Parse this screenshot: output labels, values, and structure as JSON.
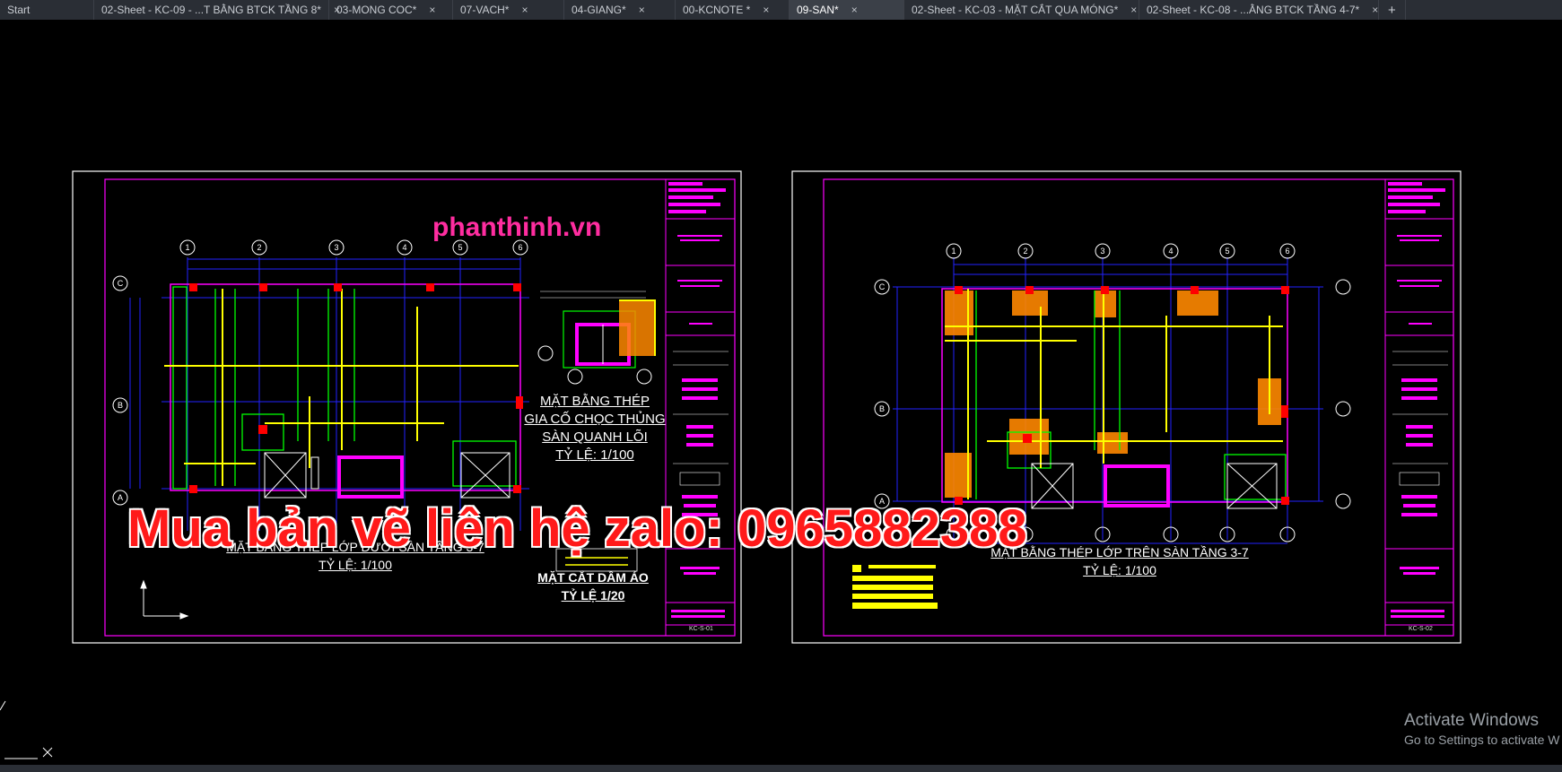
{
  "tabs": [
    {
      "label": "Start",
      "close": false
    },
    {
      "label": "02-Sheet - KC-09 - ...T BẰNG BTCK TẦNG 8*",
      "close": true
    },
    {
      "label": "03-MONG COC*",
      "close": true
    },
    {
      "label": "07-VACH*",
      "close": true
    },
    {
      "label": "04-GIANG*",
      "close": true
    },
    {
      "label": "00-KCNOTE *",
      "close": true
    },
    {
      "label": "09-SAN*",
      "close": true,
      "active": true
    },
    {
      "label": "02-Sheet - KC-03 - MẶT CẮT QUA MÓNG*",
      "close": true
    },
    {
      "label": "02-Sheet - KC-08 - ...ẰNG BTCK TẦNG 4-7*",
      "close": true
    }
  ],
  "new_tab_symbol": "+",
  "close_symbol": "×",
  "watermark_site": "phanthinh.vn",
  "watermark_contact": "Mua bản vẽ liên hệ zalo: 0965882388",
  "sheet1": {
    "title_main_lines": [
      "MẶT BẰNG THÉP LỚP DƯỚI SÀN TẦNG 3-7",
      "TỶ LỆ: 1/100"
    ],
    "title_detail_lines": [
      "MẶT BẰNG THÉP",
      "GIA CỐ CHỌC THỦNG",
      "SÀN QUANH LÕI",
      "TỶ LỆ: 1/100"
    ],
    "title_section_lines": [
      "MẶT CẮT DẦM ẢO",
      "TỶ LỆ 1/20"
    ],
    "sheet_code": "KC-S-01"
  },
  "sheet2": {
    "title_main_lines": [
      "MẶT BẰNG THÉP LỚP TRÊN SÀN TẦNG 3-7",
      "TỶ LỆ: 1/100"
    ],
    "sheet_code": "KC-S-02"
  },
  "grid_numbers": [
    "1",
    "2",
    "3",
    "4",
    "5",
    "6"
  ],
  "grid_letters": [
    "C",
    "B",
    "A"
  ],
  "activate_windows": {
    "line1": "Activate Windows",
    "line2": "Go to Settings to activate W"
  },
  "colors": {
    "tabbar_bg": "#2a2e35",
    "sheet_border": "#ffffff",
    "inner_frame": "#ff00ff",
    "grid": "#2222ff",
    "rebar": "#ffff00",
    "columns": "#ff0000",
    "walls": "#00ff00"
  }
}
